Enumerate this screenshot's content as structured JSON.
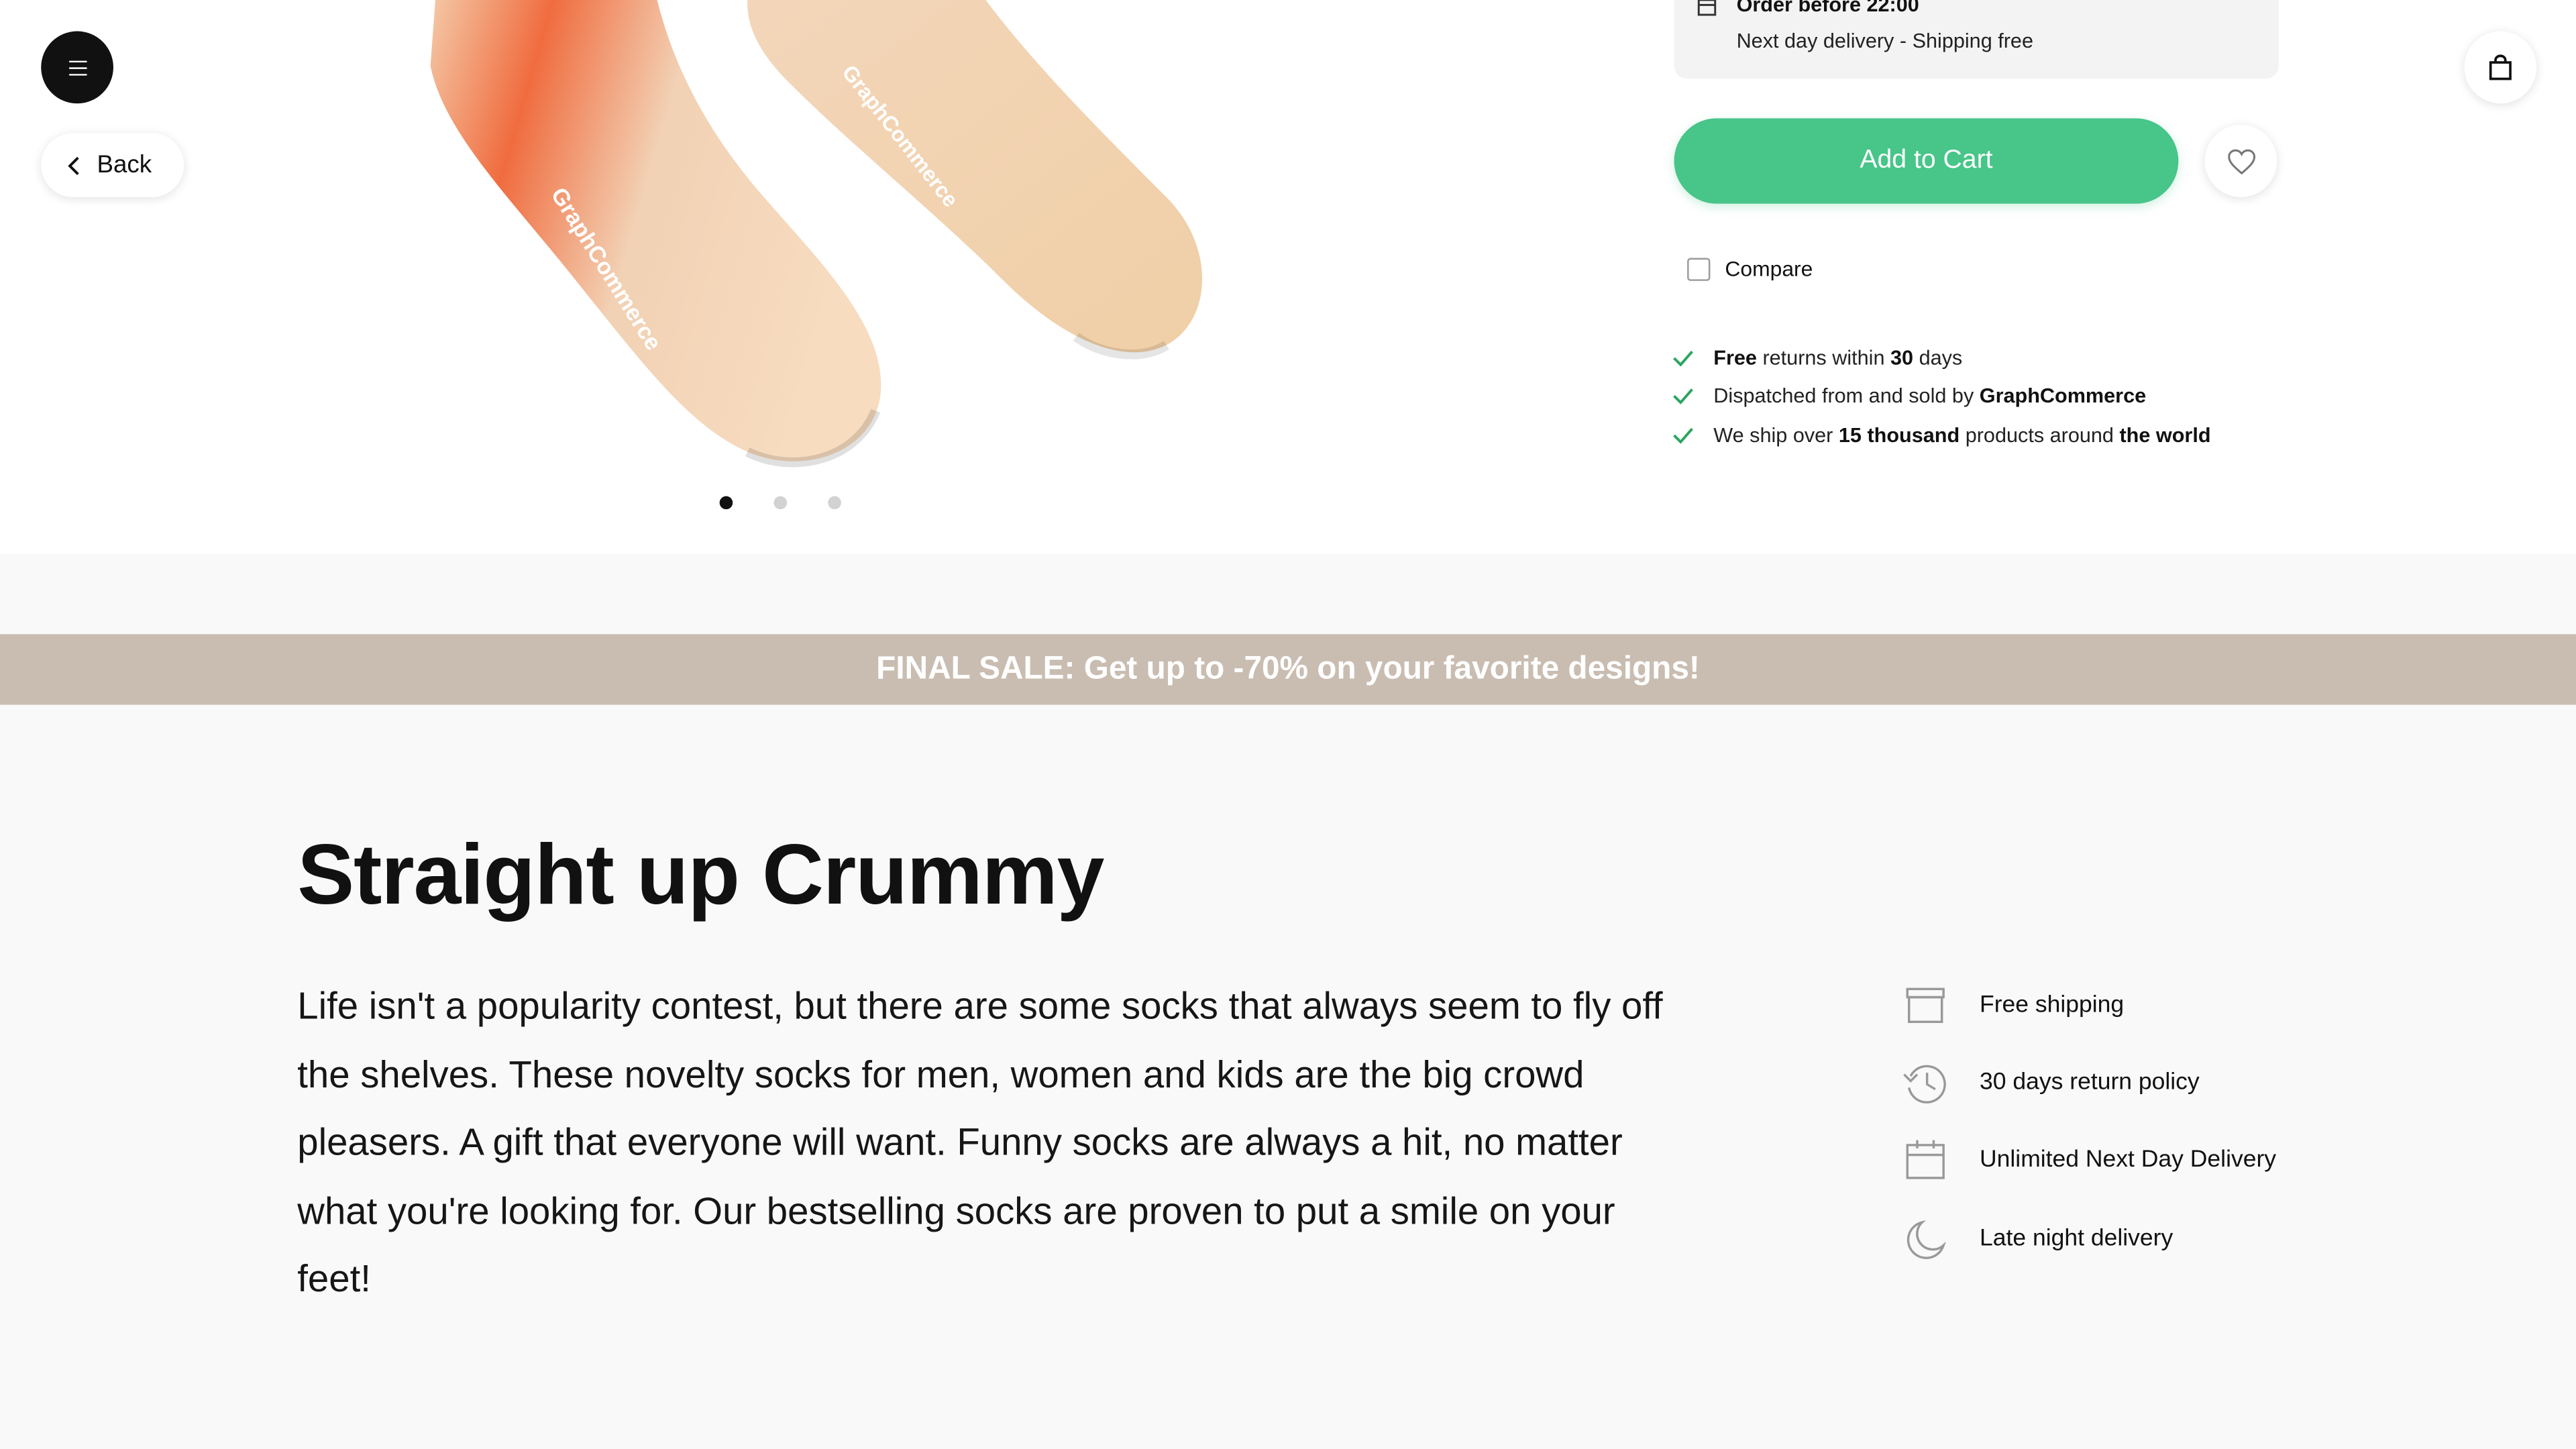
{
  "header": {
    "menu_icon": "hamburger-icon",
    "back_label": "Back",
    "cart_icon": "shopping-bag-icon"
  },
  "gallery": {
    "image_alt": "GraphCommerce novelty socks",
    "image_brand_text": "GraphCommerce",
    "dots_count": 3,
    "active_dot": 1
  },
  "delivery": {
    "title": "Order before 22:00",
    "subtitle": "Next day delivery - Shipping free"
  },
  "actions": {
    "add_to_cart": "Add to Cart",
    "wishlist_icon": "heart-icon",
    "compare_label": "Compare"
  },
  "usps": [
    {
      "pre": "",
      "b1": "Free",
      "mid": " returns within ",
      "b2": "30",
      "post": " days"
    },
    {
      "pre": "Dispatched from and sold by ",
      "b1": "GraphCommerce",
      "mid": "",
      "b2": "",
      "post": ""
    },
    {
      "pre": "We ship over ",
      "b1": "15 thousand",
      "mid": " products around ",
      "b2": "the world",
      "post": ""
    }
  ],
  "sale_banner": "FINAL SALE: Get up to -70% on your favorite designs!",
  "content": {
    "headline": "Straight up Crummy",
    "body": "Life isn't a popularity contest, but there are some socks that always seem to fly off the shelves. These novelty socks for men, women and kids are the big crowd pleasers. A gift that everyone will want. Funny socks are always a hit, no matter what you're looking for. Our bestselling socks are proven to put a smile on your feet!"
  },
  "features": [
    {
      "label": "Free shipping",
      "icon": "box-icon"
    },
    {
      "label": "30 days return policy",
      "icon": "history-icon"
    },
    {
      "label": "Unlimited Next Day Delivery",
      "icon": "calendar-icon"
    },
    {
      "label": "Late night delivery",
      "icon": "moon-icon"
    }
  ],
  "colors": {
    "accent_green": "#48c589",
    "sale_bar": "#c9bdb1",
    "check_green": "#2aa55e"
  }
}
